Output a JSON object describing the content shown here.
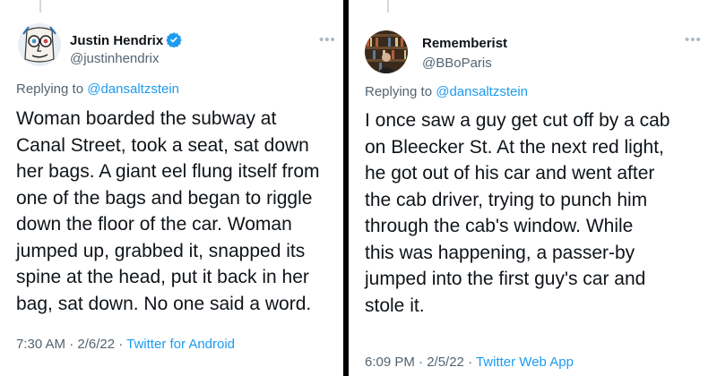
{
  "tweets": [
    {
      "name": "Justin Hendrix",
      "handle": "@justinhendrix",
      "replying_prefix": "Replying to ",
      "replying_to": "@dansaltzstein",
      "text": "Woman boarded the subway at\nCanal Street, took a seat, sat down\nher bags. A giant eel flung itself from\none of the bags and began to riggle\ndown the floor of the car. Woman\njumped up, grabbed it, snapped its\nspine at the head, put it back in her\nbag, sat down. No one said a word.",
      "time": "7:30 AM · 2/6/22 · ",
      "source": "Twitter for Android",
      "verified": true,
      "avatar_icon": "sketch-face-avatar"
    },
    {
      "name": "Rememberist",
      "handle": "@BBoParis",
      "replying_prefix": "Replying to ",
      "replying_to": "@dansaltzstein",
      "text": "I once saw a guy get cut off by a cab\non Bleecker St. At the next red light,\nhe got out of his car and went after\nthe cab driver, trying to punch him\nthrough the cab's window. While\nthis was happening, a passer-by\njumped into the first guy's car and\nstole it.",
      "time": "6:09 PM · 2/5/22 · ",
      "source": "Twitter Web App",
      "verified": false,
      "avatar_icon": "bookshelf-photo-avatar"
    }
  ],
  "colors": {
    "link": "#1d9bf0",
    "text": "#0f1419",
    "muted": "#536471",
    "divider": "#000000"
  }
}
